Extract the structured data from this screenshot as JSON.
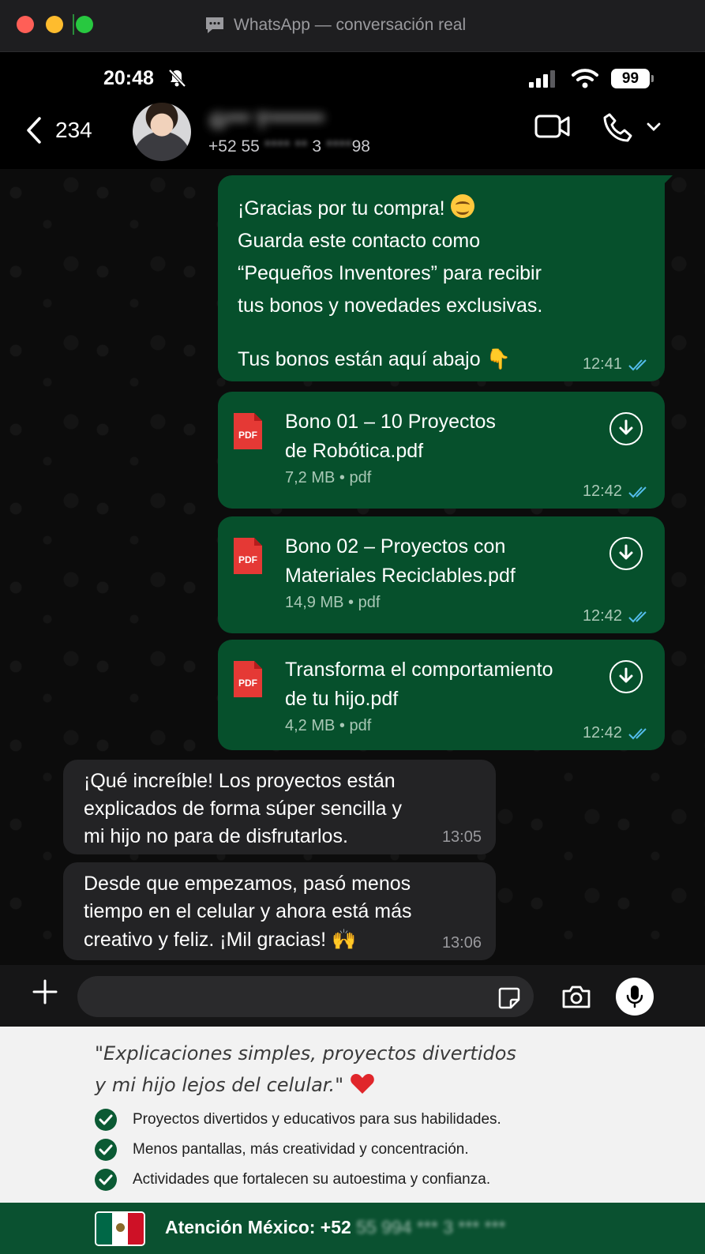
{
  "window": {
    "title": "WhatsApp — conversación real"
  },
  "status_bar": {
    "time": "20:48",
    "battery": "99"
  },
  "header": {
    "back_count": "234",
    "contact_name": "G*** T*******",
    "phone_prefix": "+52 55",
    "phone_masked_1": "**** **",
    "phone_mid": "3",
    "phone_masked_2": "****",
    "phone_suffix": "98"
  },
  "messages": {
    "welcome": {
      "line1": "¡Gracias por tu compra!",
      "line2": "Guarda este contacto como",
      "line3": "“Pequeños Inventores” para recibir",
      "line4": "tus bonos y novedades exclusivas.",
      "line5": "Tus bonos están aquí abajo",
      "emoji_point": "👇",
      "time": "12:41"
    },
    "documents": [
      {
        "title_line1": "Bono 01 – 10 Proyectos",
        "title_line2": "de Robótica.pdf",
        "meta": "7,2 MB • pdf",
        "time": "12:42",
        "icon_label": "PDF"
      },
      {
        "title_line1": "Bono 02 – Proyectos con",
        "title_line2": "Materiales Reciclables.pdf",
        "meta": "14,9 MB • pdf",
        "time": "12:42",
        "icon_label": "PDF"
      },
      {
        "title_line1": "Transforma el comportamiento",
        "title_line2": "de tu hijo.pdf",
        "meta": "4,2 MB • pdf",
        "time": "12:42",
        "icon_label": "PDF"
      }
    ],
    "incoming": [
      {
        "line1": "¡Qué increíble! Los proyectos están",
        "line2": "explicados de forma súper sencilla y",
        "line3": "mi hijo no para de disfrutarlos.",
        "time": "13:05"
      },
      {
        "line1": "Desde que empezamos, pasó menos",
        "line2": "tiempo en el celular y ahora está más",
        "line3": "creativo y feliz. ¡Mil gracias!",
        "emoji": "🙌",
        "time": "13:06"
      }
    ]
  },
  "input": {
    "placeholder": ""
  },
  "promo": {
    "quote_line1": "\"Explicaciones simples, proyectos divertidos",
    "quote_line2": "y mi hijo lejos del celular.\"",
    "bullets": [
      "Proyectos divertidos y educativos para sus habilidades.",
      "Menos pantallas, más creatividad y concentración.",
      "Actividades que fortalecen su autoestima y confianza."
    ]
  },
  "footer": {
    "label": "Atención México: +52",
    "masked": "55 994 *** 3 *** ***"
  },
  "colors": {
    "outgoing_bubble": "#06502c",
    "incoming_bubble": "#232325",
    "footer_bg": "#0a5130",
    "check": "#0b5a34",
    "tick_read": "#53bdeb"
  }
}
